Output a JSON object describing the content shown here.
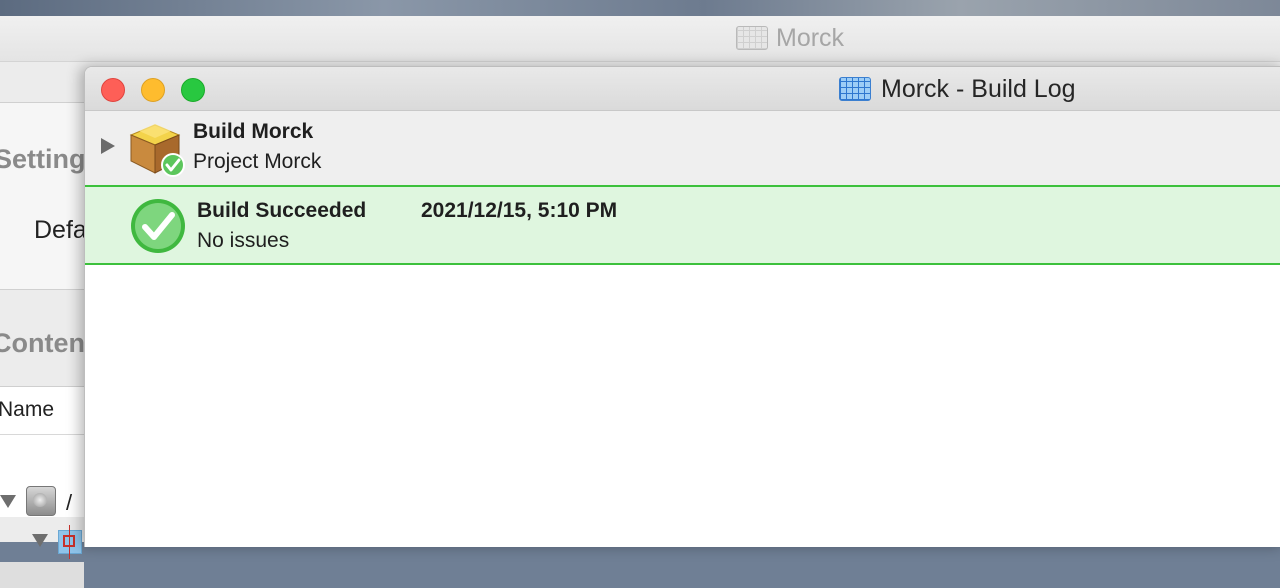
{
  "back_window": {
    "title": "Morck",
    "sidebar": {
      "settings_header": "Setting",
      "default_label": "Defa",
      "content_header": "Content",
      "table_header": "Name",
      "root_item": "/"
    }
  },
  "build_log_window": {
    "title": "Morck - Build Log",
    "build_item": {
      "title": "Build Morck",
      "subtitle": "Project Morck"
    },
    "result_item": {
      "title": "Build Succeeded",
      "timestamp": "2021/12/15, 5:10 PM",
      "subtitle": "No issues",
      "status_color": "#3cc13c"
    }
  }
}
